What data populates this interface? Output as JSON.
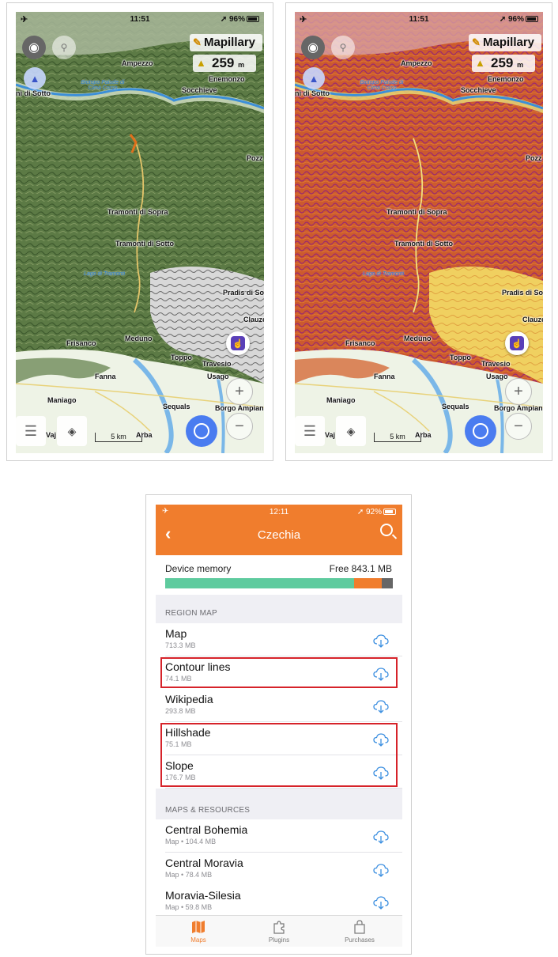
{
  "status_top": {
    "time": "11:51",
    "battery": "96%"
  },
  "map_left": {
    "style": "hillshade"
  },
  "map_right": {
    "style": "slope"
  },
  "map_overlay": {
    "mapillary": "Mapillary",
    "altitude": "259",
    "altitude_unit": "m",
    "scale": "5 km",
    "places": {
      "ampezzo": "Ampezzo",
      "enemonzo": "Enemonzo",
      "socchieve": "Socchieve",
      "sotto_left": "ni di Sotto",
      "pozz": "Pozz",
      "tramonti_sopra": "Tramonti di Sopra",
      "tramonti_sotto": "Tramonti di Sotto",
      "pradis": "Pradis di So",
      "clauz": "Clauzo",
      "frisanco": "Frisanco",
      "meduno": "Meduno",
      "toppo": "Toppo",
      "travesio": "Travesio",
      "fanna": "Fanna",
      "usago": "Usago",
      "maniago": "Maniago",
      "sequals": "Sequals",
      "borgo": "Borgo Ampian",
      "arba": "Arba",
      "vaj": "Vaj",
      "lake1": "Biotopo Palude di Cima Corso",
      "lake2": "Lago di Tramonti"
    }
  },
  "app": {
    "status": {
      "time": "12:11",
      "battery": "92%"
    },
    "title": "Czechia",
    "memory": {
      "label": "Device memory",
      "free": "Free 843.1 MB",
      "used_fraction": 0.83,
      "other_fraction": 0.12,
      "reserved_fraction": 0.05,
      "colors": {
        "used": "#5ecb9e",
        "other": "#f07d2d",
        "reserved": "#666666"
      }
    },
    "region_section": "REGION MAP",
    "region_items": [
      {
        "name": "Map",
        "size": "713.3 MB",
        "highlighted": false
      },
      {
        "name": "Contour lines",
        "size": "74.1 MB",
        "highlighted": true
      },
      {
        "name": "Wikipedia",
        "size": "293.8 MB",
        "highlighted": false
      },
      {
        "name": "Hillshade",
        "size": "75.1 MB",
        "highlighted": true
      },
      {
        "name": "Slope",
        "size": "176.7 MB",
        "highlighted": true
      }
    ],
    "resources_section": "MAPS & RESOURCES",
    "resource_items": [
      {
        "name": "Central Bohemia",
        "size": "Map  •  104.4 MB"
      },
      {
        "name": "Central Moravia",
        "size": "Map  •  78.4 MB"
      },
      {
        "name": "Moravia-Silesia",
        "size": "Map  •  59.8 MB"
      }
    ],
    "tabs": [
      {
        "label": "Maps",
        "icon": "map-icon",
        "active": true
      },
      {
        "label": "Plugins",
        "icon": "puzzle-icon",
        "active": false
      },
      {
        "label": "Purchases",
        "icon": "bag-icon",
        "active": false
      }
    ],
    "accent": "#f07d2d",
    "highlight_color": "#d6232a"
  }
}
